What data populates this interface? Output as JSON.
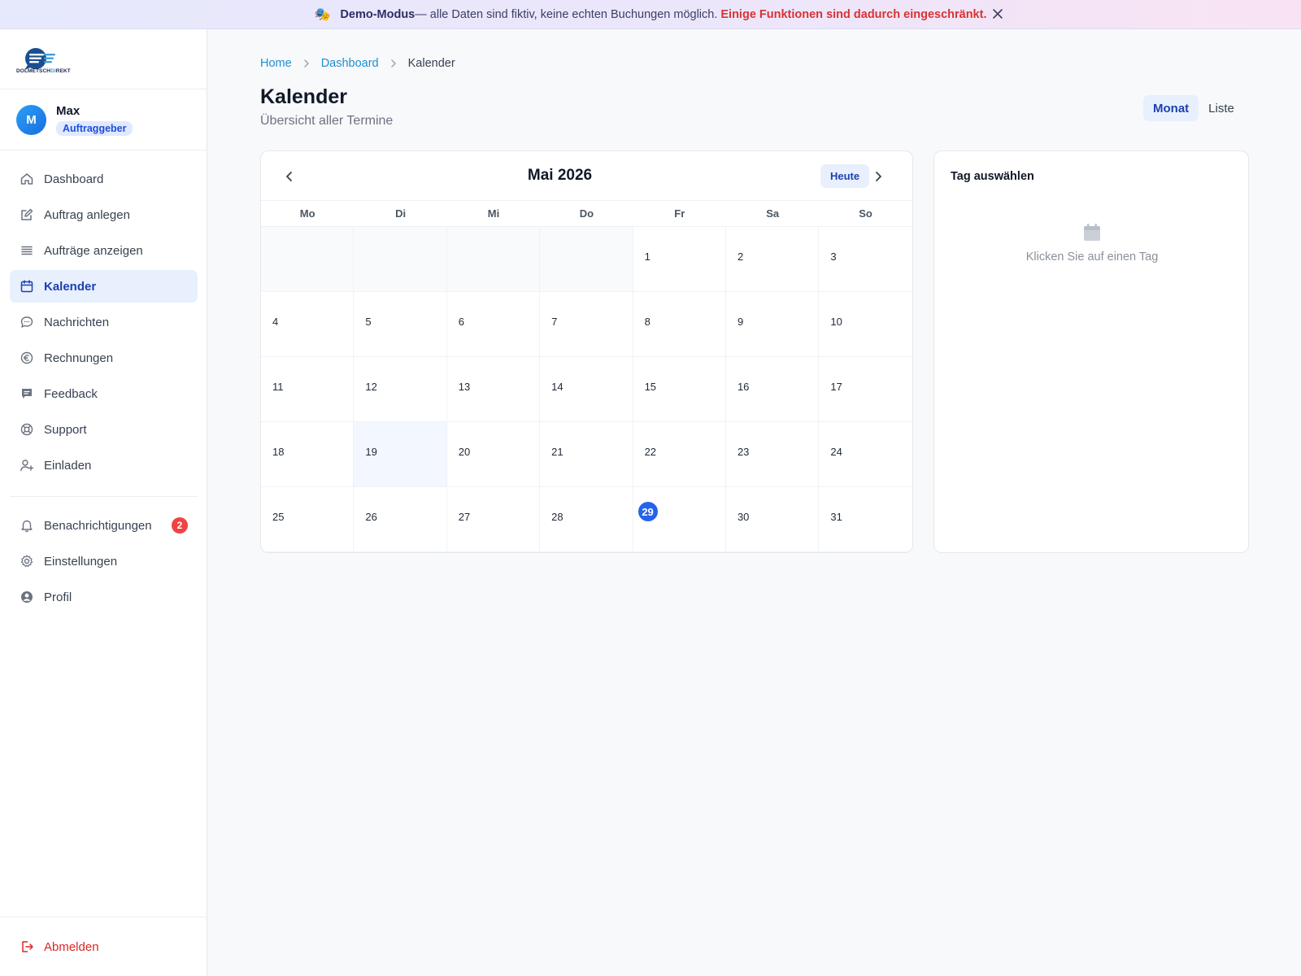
{
  "banner": {
    "icon": "theater-mask-icon",
    "strong": "Demo-Modus",
    "text": " — alle Daten sind fiktiv, keine echten Buchungen möglich.",
    "warning": "Einige Funktionen sind dadurch eingeschränkt."
  },
  "sidebar": {
    "logo_text_a": "DOLMETSCH",
    "logo_text_b": "DI",
    "logo_text_c": "REKT",
    "user": {
      "initial": "M",
      "name": "Max",
      "role": "Auftraggeber"
    },
    "items": [
      {
        "label": "Dashboard",
        "icon": "home-icon"
      },
      {
        "label": "Auftrag anlegen",
        "icon": "edit-icon"
      },
      {
        "label": "Aufträge anzeigen",
        "icon": "list-icon"
      },
      {
        "label": "Kalender",
        "icon": "calendar-icon",
        "active": true
      },
      {
        "label": "Nachrichten",
        "icon": "chat-icon"
      },
      {
        "label": "Rechnungen",
        "icon": "euro-icon"
      },
      {
        "label": "Feedback",
        "icon": "feedback-icon"
      },
      {
        "label": "Support",
        "icon": "lifebuoy-icon"
      },
      {
        "label": "Einladen",
        "icon": "user-plus-icon"
      }
    ],
    "secondary": [
      {
        "label": "Benachrichtigungen",
        "icon": "bell-icon",
        "badge": "2"
      },
      {
        "label": "Einstellungen",
        "icon": "gear-icon"
      },
      {
        "label": "Profil",
        "icon": "user-icon"
      }
    ],
    "logout": "Abmelden"
  },
  "breadcrumb": {
    "home": "Home",
    "dashboard": "Dashboard",
    "current": "Kalender"
  },
  "page": {
    "title": "Kalender",
    "subtitle": "Übersicht aller Termine"
  },
  "views": {
    "month": "Monat",
    "list": "Liste"
  },
  "calendar": {
    "month_label": "Mai 2026",
    "today_label": "Heute",
    "weekdays": [
      "Mo",
      "Di",
      "Mi",
      "Do",
      "Fr",
      "Sa",
      "So"
    ],
    "leading_empty": 4,
    "days": [
      "1",
      "2",
      "3",
      "4",
      "5",
      "6",
      "7",
      "8",
      "9",
      "10",
      "11",
      "12",
      "13",
      "14",
      "15",
      "16",
      "17",
      "18",
      "19",
      "20",
      "21",
      "22",
      "23",
      "24",
      "25",
      "26",
      "27",
      "28",
      "29",
      "30",
      "31"
    ],
    "today": "29",
    "highlighted": "19"
  },
  "day_panel": {
    "title": "Tag auswählen",
    "empty_text": "Klicken Sie auf einen Tag"
  },
  "colors": {
    "accent": "#2563eb",
    "active_bg": "#e8f0fe",
    "danger": "#dc2626",
    "link": "#1e8fd0"
  }
}
